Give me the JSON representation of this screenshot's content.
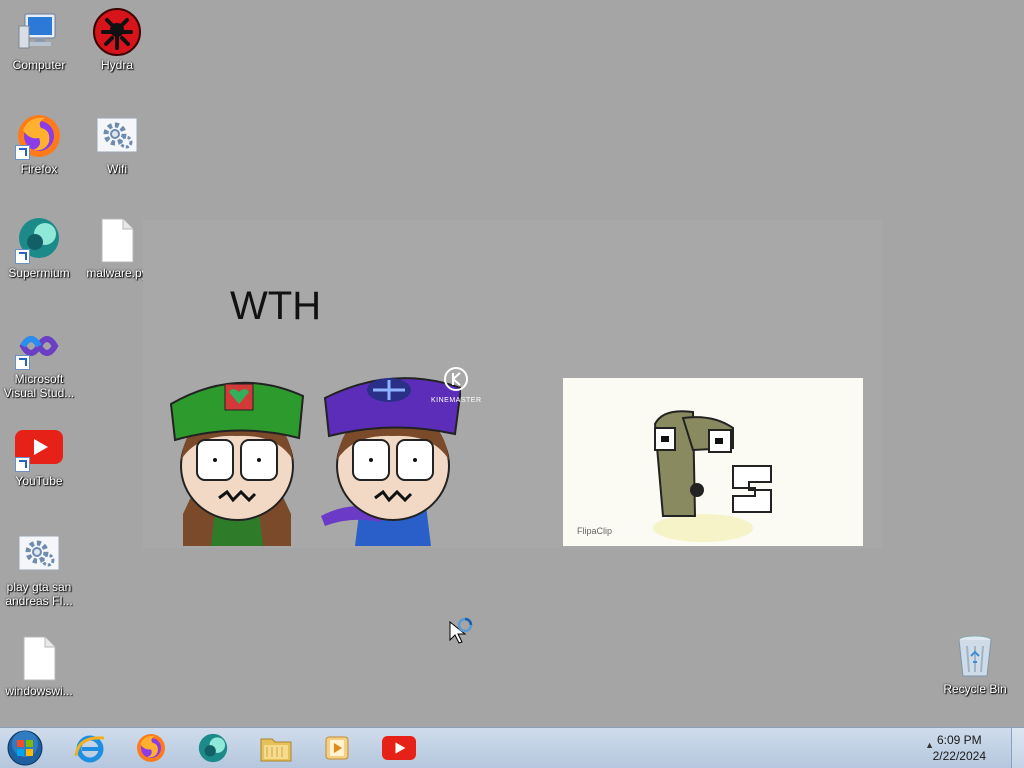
{
  "desktop": {
    "icons": [
      {
        "label": "Computer",
        "icon": "computer-icon"
      },
      {
        "label": "Hydra",
        "icon": "hydra-icon"
      },
      {
        "label": "Firefox",
        "icon": "firefox-icon"
      },
      {
        "label": "Wifi",
        "icon": "settings-gear-icon"
      },
      {
        "label": "Supermium",
        "icon": "supermium-icon"
      },
      {
        "label": "malware.py",
        "icon": "file-icon"
      },
      {
        "label": "Microsoft Visual Stud...",
        "icon": "visual-studio-icon"
      },
      {
        "label": "YouTube",
        "icon": "youtube-icon"
      },
      {
        "label": "play gta san andreas FI...",
        "icon": "settings-gear-icon"
      },
      {
        "label": "windowswi...",
        "icon": "file-icon"
      },
      {
        "label": "Recycle Bin",
        "icon": "recycle-bin-icon"
      }
    ]
  },
  "overlay": {
    "caption": "WTH",
    "watermark": "KINEMASTER",
    "inset_credit": "FlipaClip"
  },
  "taskbar": {
    "pinned": [
      "start-orb-icon",
      "internet-explorer-icon",
      "firefox-icon",
      "supermium-icon",
      "file-explorer-icon",
      "media-player-icon",
      "youtube-icon"
    ],
    "clock": {
      "time": "6:09 PM",
      "date": "2/22/2024"
    },
    "tray_arrow": "▲"
  },
  "colors": {
    "desktop_bg": "#a5a5a5",
    "taskbar": "#c2d2e6",
    "youtube_red": "#e62117"
  }
}
